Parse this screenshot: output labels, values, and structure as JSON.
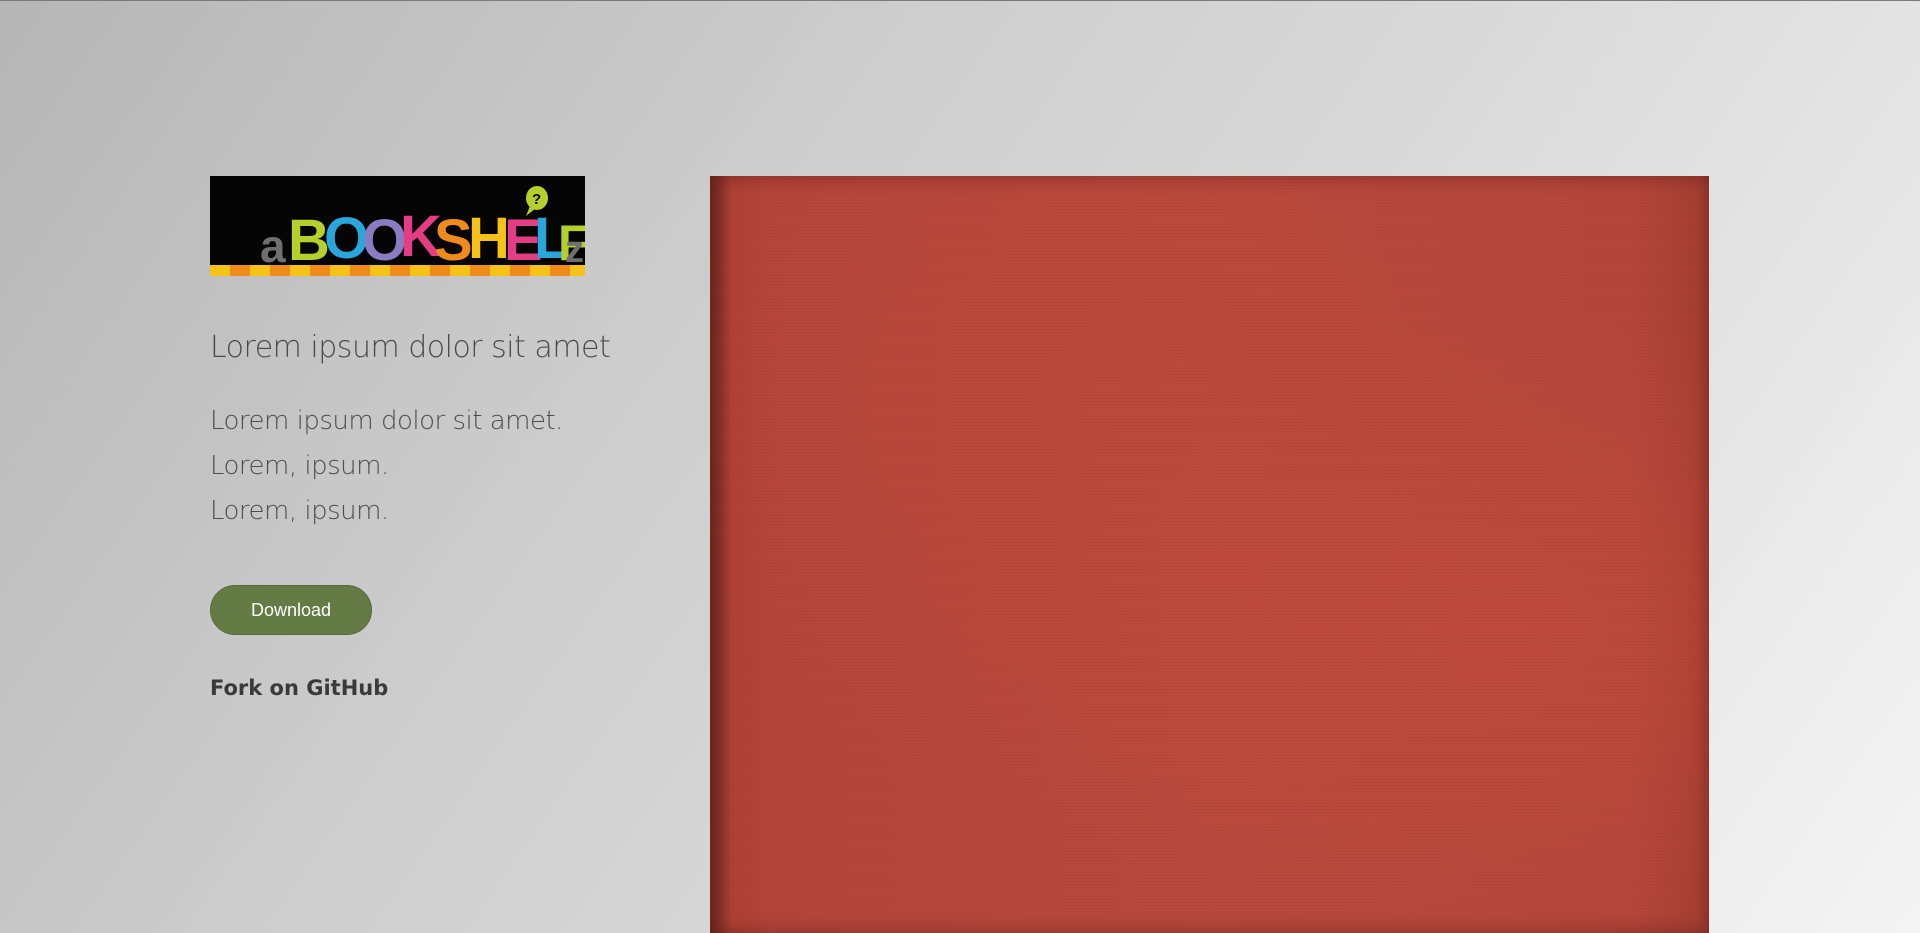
{
  "logo": {
    "text": "aBOOKSHELFz",
    "badge": "?"
  },
  "hero": {
    "headline": "Lorem ipsum dolor sit amet",
    "lines": [
      "Lorem ipsum dolor sit amet.",
      "Lorem, ipsum.",
      "Lorem, ipsum."
    ],
    "download_label": "Download",
    "fork_label": "Fork on GitHub"
  },
  "colors": {
    "button": "#647b46",
    "book_cover": "#b4453a"
  }
}
